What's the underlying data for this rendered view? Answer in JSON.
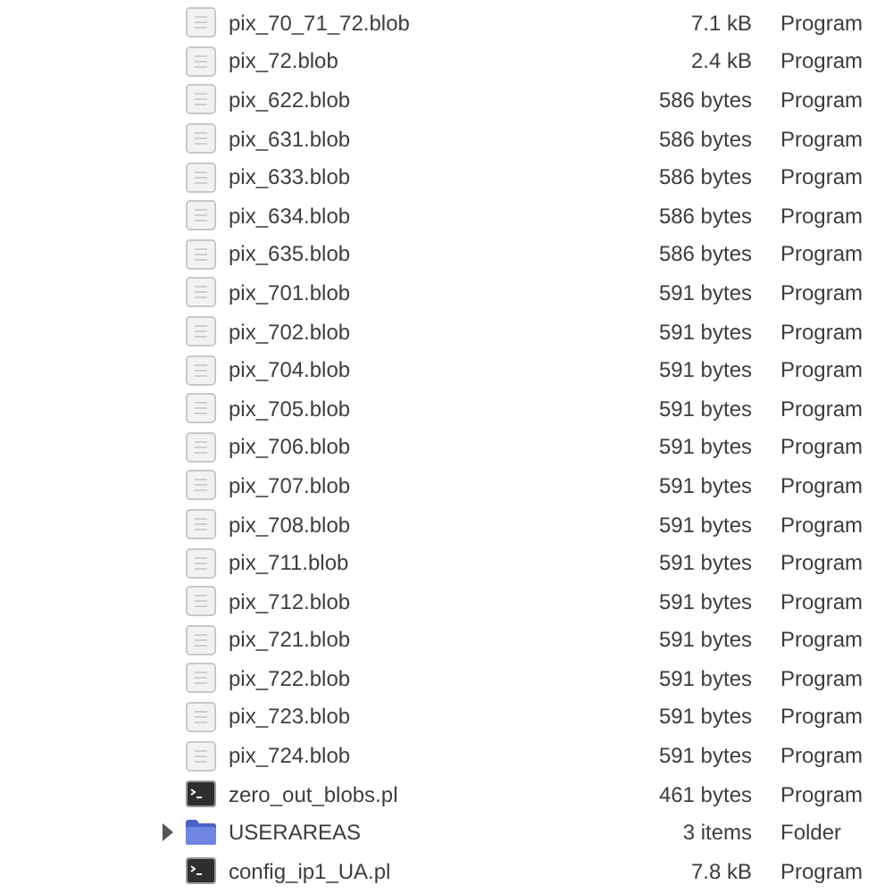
{
  "tree": [
    {
      "children": [
        {
          "kind": "blob",
          "name": "pix_70_71_72.blob",
          "size": "7.1 kB",
          "type": "Program"
        },
        {
          "kind": "blob",
          "name": "pix_72.blob",
          "size": "2.4 kB",
          "type": "Program"
        },
        {
          "kind": "blob",
          "name": "pix_622.blob",
          "size": "586 bytes",
          "type": "Program"
        },
        {
          "kind": "blob",
          "name": "pix_631.blob",
          "size": "586 bytes",
          "type": "Program"
        },
        {
          "kind": "blob",
          "name": "pix_633.blob",
          "size": "586 bytes",
          "type": "Program"
        },
        {
          "kind": "blob",
          "name": "pix_634.blob",
          "size": "586 bytes",
          "type": "Program"
        },
        {
          "kind": "blob",
          "name": "pix_635.blob",
          "size": "586 bytes",
          "type": "Program"
        },
        {
          "kind": "blob",
          "name": "pix_701.blob",
          "size": "591 bytes",
          "type": "Program"
        },
        {
          "kind": "blob",
          "name": "pix_702.blob",
          "size": "591 bytes",
          "type": "Program"
        },
        {
          "kind": "blob",
          "name": "pix_704.blob",
          "size": "591 bytes",
          "type": "Program"
        },
        {
          "kind": "blob",
          "name": "pix_705.blob",
          "size": "591 bytes",
          "type": "Program"
        },
        {
          "kind": "blob",
          "name": "pix_706.blob",
          "size": "591 bytes",
          "type": "Program"
        },
        {
          "kind": "blob",
          "name": "pix_707.blob",
          "size": "591 bytes",
          "type": "Program"
        },
        {
          "kind": "blob",
          "name": "pix_708.blob",
          "size": "591 bytes",
          "type": "Program"
        },
        {
          "kind": "blob",
          "name": "pix_711.blob",
          "size": "591 bytes",
          "type": "Program"
        },
        {
          "kind": "blob",
          "name": "pix_712.blob",
          "size": "591 bytes",
          "type": "Program"
        },
        {
          "kind": "blob",
          "name": "pix_721.blob",
          "size": "591 bytes",
          "type": "Program"
        },
        {
          "kind": "blob",
          "name": "pix_722.blob",
          "size": "591 bytes",
          "type": "Program"
        },
        {
          "kind": "blob",
          "name": "pix_723.blob",
          "size": "591 bytes",
          "type": "Program"
        },
        {
          "kind": "blob",
          "name": "pix_724.blob",
          "size": "591 bytes",
          "type": "Program"
        },
        {
          "kind": "script",
          "name": "zero_out_blobs.pl",
          "size": "461 bytes",
          "type": "Program"
        }
      ]
    },
    {
      "kind": "folder",
      "name": "USERAREAS",
      "size": "3 items",
      "type": "Folder",
      "expanded": false
    },
    {
      "kind": "script",
      "name": "config_ip1_UA.pl",
      "size": "7.8 kB",
      "type": "Program"
    }
  ]
}
